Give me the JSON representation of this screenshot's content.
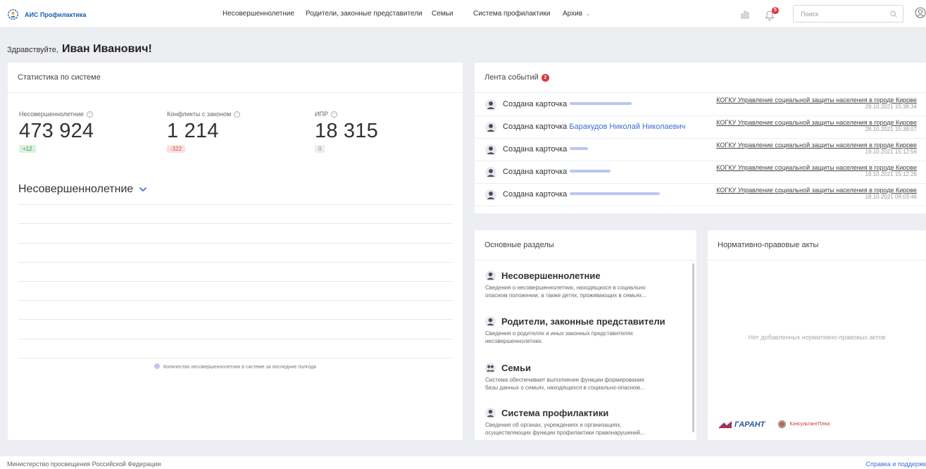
{
  "app": {
    "title": "АИС Профилактика"
  },
  "nav": {
    "items": [
      {
        "label": "Несовершеннолетние"
      },
      {
        "label": "Родители, законные представители"
      },
      {
        "label": "Семьи"
      },
      {
        "label": "Система профилактики"
      },
      {
        "label": "Архив"
      }
    ]
  },
  "header": {
    "notifications_count": "5",
    "search_placeholder": "Поиск"
  },
  "greeting": {
    "prefix": "Здравствуйте,",
    "name": "Иван Иванович!"
  },
  "stats": {
    "title": "Статистика по системе",
    "items": [
      {
        "label": "Несовершеннолетние",
        "value": "473 924",
        "delta": "+12"
      },
      {
        "label": "Конфликты с законом",
        "value": "1 214",
        "delta": "-322"
      },
      {
        "label": "ИПР",
        "value": "18 315",
        "delta": "0"
      }
    ],
    "chart_title": "Несовершеннолетние",
    "legend": "Количество несовершеннолетних в системе за последние полгода"
  },
  "feed": {
    "title": "Лента событий",
    "badge": "2",
    "events": [
      {
        "action": "Создана карточка",
        "name": "",
        "org": "КОГКУ Управление социальной защиты населения в городе Кирове",
        "date": "28.10.2021 15:38:34"
      },
      {
        "action": "Создана карточка",
        "name": "Баракудов Николай Николаевич",
        "org": "КОГКУ Управление социальной защиты населения в городе Кирове",
        "date": "28.10.2021 15:38:07"
      },
      {
        "action": "Создана карточка",
        "name": "",
        "org": "КОГКУ Управление социальной защиты населения в городе Кирове",
        "date": "19.10.2021 15:12:56"
      },
      {
        "action": "Создана карточка",
        "name": "",
        "org": "КОГКУ Управление социальной защиты населения в городе Кирове",
        "date": "19.10.2021 15:12:26"
      },
      {
        "action": "Создана карточка",
        "name": "",
        "org": "КОГКУ Управление социальной защиты населения в городе Кирове",
        "date": "18.10.2021 09:03:46"
      }
    ]
  },
  "sections": {
    "title": "Основные разделы",
    "items": [
      {
        "title": "Несовершеннолетние",
        "desc1": "Сведения о несовершеннолетних, находящихся в социально",
        "desc2": "опасном положении, а также детях, проживающих в семьях..."
      },
      {
        "title": "Родители, законные представители",
        "desc1": "Сведения о родителях и иных законных представителях",
        "desc2": "несовершеннолетних."
      },
      {
        "title": "Семьи",
        "desc1": "Система обеспечивает выполнение функции формирования",
        "desc2": "базы данных о семьях, находящихся в социально-опасном..."
      },
      {
        "title": "Система профилактики",
        "desc1": "Сведения об органах, учреждениях и организациях,",
        "desc2": "осуществляющих функции профилактики правонарушений..."
      }
    ]
  },
  "laws": {
    "title": "Нормативно-правовые акты",
    "empty": "Нет добавленных нормативно-правовых актов",
    "garant_label": "ГАРАНТ",
    "consultant_label": "КонсультантПлюс"
  },
  "footer": {
    "left": "Министерство просвещения Российской Федерации",
    "right": "Справка и поддержк"
  },
  "colors": {
    "accent": "#3a6fd6",
    "badge": "#e0333e",
    "background": "#edeef2"
  },
  "icons": [
    "logo-icon",
    "chart-icon",
    "bell-icon",
    "search-icon",
    "user-icon",
    "info-icon",
    "chevron-down-icon",
    "avatar-icon",
    "family-icon"
  ]
}
